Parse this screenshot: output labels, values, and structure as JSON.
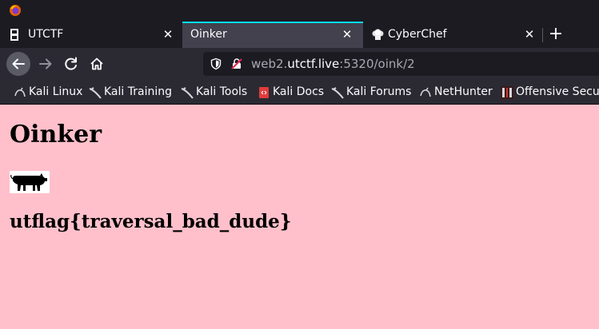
{
  "browser": {
    "tabs": [
      {
        "title": "UTCTF",
        "icon": "utctf-favicon-icon",
        "active": false
      },
      {
        "title": "Oinker",
        "icon": "",
        "active": true
      },
      {
        "title": "CyberChef",
        "icon": "cyberchef-chef-hat-icon",
        "active": false
      }
    ],
    "close_glyph": "✕",
    "newtab_glyph": "+",
    "url": {
      "prefix": "web2.",
      "host": "utctf.live",
      "suffix": ":5320/oink/2"
    },
    "accent": "#00ddff"
  },
  "bookmarks": [
    {
      "label": "Kali Linux",
      "icon": "kali-dragon-icon"
    },
    {
      "label": "Kali Training",
      "icon": "kali-dragon-icon"
    },
    {
      "label": "Kali Tools",
      "icon": "kali-dragon-icon"
    },
    {
      "label": "Kali Docs",
      "icon": "kali-docs-icon"
    },
    {
      "label": "Kali Forums",
      "icon": "kali-dragon-icon"
    },
    {
      "label": "NetHunter",
      "icon": "kali-dragon-icon"
    },
    {
      "label": "Offensive Secur",
      "icon": "offsec-icon"
    }
  ],
  "page": {
    "heading": "Oinker",
    "image": "pig-silhouette-image",
    "flag": "utflag{traversal_bad_dude}",
    "background": "#ffc0cb"
  }
}
